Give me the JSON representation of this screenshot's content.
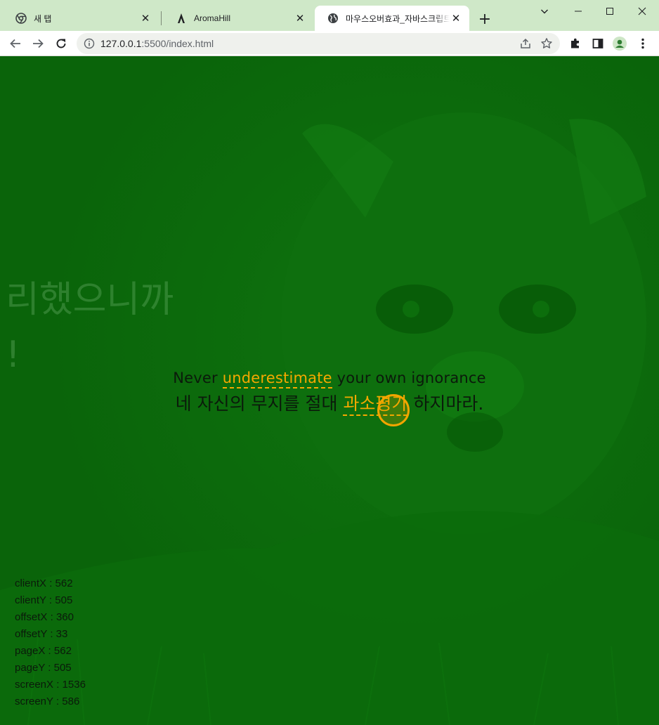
{
  "browser": {
    "tabs": [
      {
        "title": "새 탭",
        "favicon": "chrome-icon",
        "active": false
      },
      {
        "title": "AromaHill",
        "favicon": "aromahill-icon",
        "active": false
      },
      {
        "title": "마우스오버효과_자바스크립트",
        "favicon": "globe-icon",
        "active": true
      }
    ],
    "close_glyph": "✕",
    "new_tab_glyph": "+",
    "url_host": "127.0.0.1",
    "url_rest": ":5500/index.html"
  },
  "page": {
    "background_color": "#0b6a0b",
    "ghost_text": "리했으니까\n!",
    "quote_en": {
      "before": "Never ",
      "highlight": "underestimate",
      "after": " your own ignorance"
    },
    "quote_ko": {
      "before": "네 자신의 무지를 절대 ",
      "highlight": "과소평가",
      "after": " 하지마라."
    },
    "highlight_color": "#f5a800",
    "coords": [
      {
        "label": "clientX",
        "value": "562"
      },
      {
        "label": "clientY",
        "value": "505"
      },
      {
        "label": "offsetX",
        "value": "360"
      },
      {
        "label": "offsetY",
        "value": "33"
      },
      {
        "label": "pageX",
        "value": "562"
      },
      {
        "label": "pageY",
        "value": "505"
      },
      {
        "label": "screenX",
        "value": "1536"
      },
      {
        "label": "screenY",
        "value": "586"
      }
    ]
  }
}
